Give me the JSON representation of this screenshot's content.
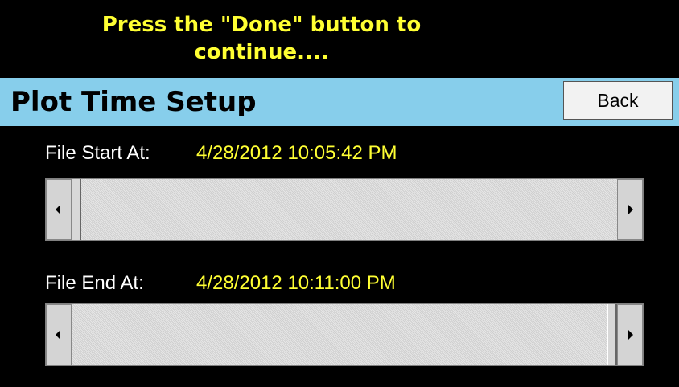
{
  "banner": {
    "message": "Press the \"Done\" button to\ncontinue...."
  },
  "header": {
    "title": "Plot Time Setup",
    "back_label": "Back"
  },
  "start": {
    "label": "File Start At:",
    "value": "4/28/2012 10:05:42 PM",
    "slider_position": 0.0
  },
  "end": {
    "label": "File End At:",
    "value": "4/28/2012 10:11:00 PM",
    "slider_position": 1.0
  },
  "colors": {
    "background": "#000000",
    "accent_text": "#ffff33",
    "title_bar": "#87ceeb"
  },
  "icons": {
    "left_arrow": "scroll-left-icon",
    "right_arrow": "scroll-right-icon"
  }
}
